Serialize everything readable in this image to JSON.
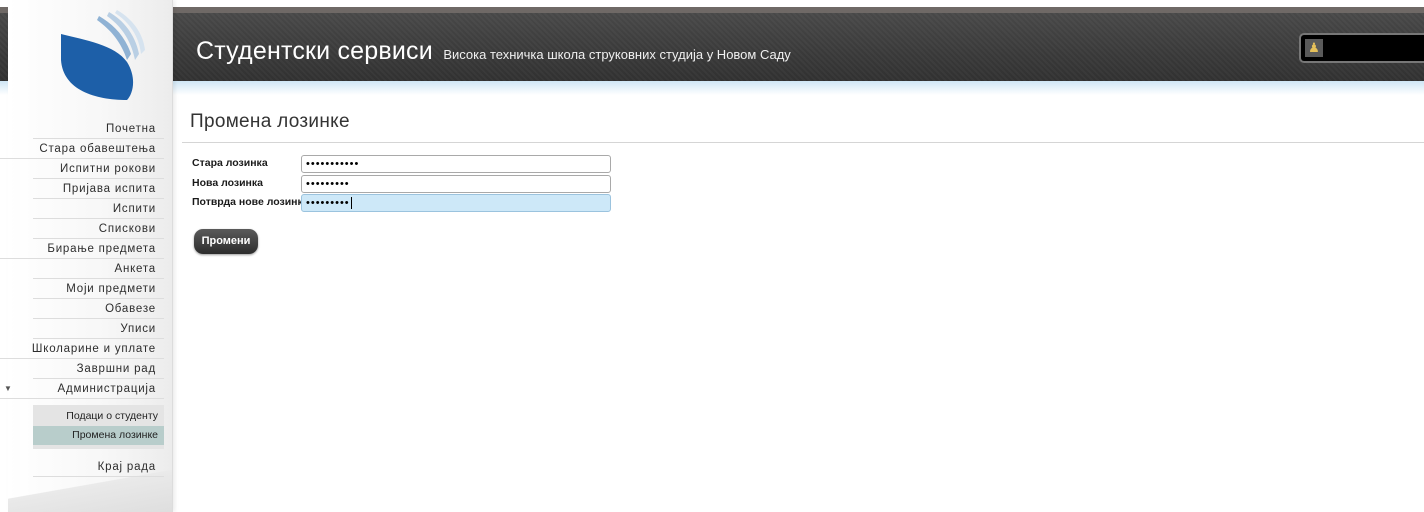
{
  "header": {
    "title": "Студентски сервиси",
    "subtitle": "Висока техничка школа струковних студија у Новом Саду"
  },
  "sidebar": {
    "items": [
      "Почетна",
      "Стара обавештења",
      "Испитни рокови",
      "Пријава испита",
      "Испити",
      "Спискови",
      "Бирање предмета",
      "Анкета",
      "Моји предмети",
      "Обавезе",
      "Уписи",
      "Школарине и уплате",
      "Завршни рад",
      "Администрација"
    ],
    "admin_sub": [
      "Подаци о студенту",
      "Промена лозинке"
    ],
    "logout": "Крај рада"
  },
  "main": {
    "title": "Промена лозинке",
    "fields": [
      {
        "label": "Стара лозинка",
        "value": "•••••••••••"
      },
      {
        "label": "Нова лозинка",
        "value": "•••••••••"
      },
      {
        "label": "Потврда нове лозинке",
        "value": "•••••••••"
      }
    ],
    "submit": "Промени"
  },
  "colors": {
    "header_bg": "#3b3b3b",
    "logo_blue": "#1d5fa8",
    "active_sub": "#b8cdcb",
    "focused_field": "#cde8f8"
  }
}
